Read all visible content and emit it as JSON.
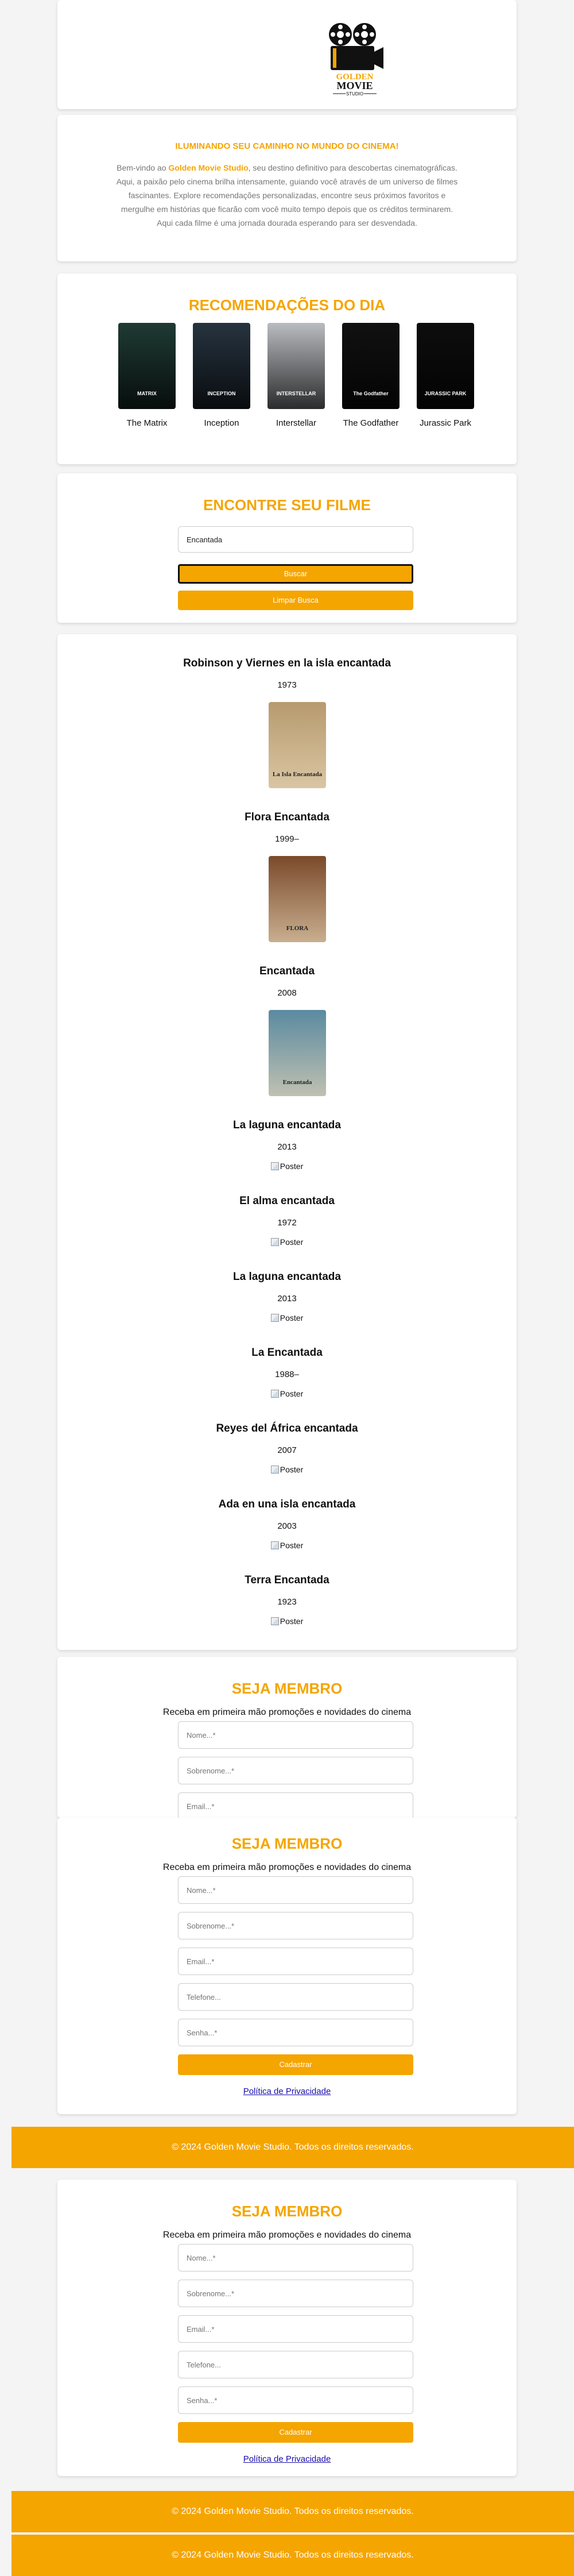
{
  "brand": {
    "logo_line1": "GOLDEN",
    "logo_line2": "MOVIE",
    "logo_line3": "STUDIO"
  },
  "intro": {
    "title": "ILUMINANDO SEU CAMINHO NO MUNDO DO CINEMA!",
    "text_before": "Bem-vindo ao ",
    "brand_name": "Golden Movie Studio",
    "text_after": ", seu destino definitivo para descobertas cinematográficas. Aqui, a paixão pelo cinema brilha intensamente, guiando você através de um universo de filmes fascinantes. Explore recomendações personalizadas, encontre seus próximos favoritos e mergulhe em histórias que ficarão com você muito tempo depois que os créditos terminarem. Aqui cada filme é uma jornada dourada esperando para ser desvendada."
  },
  "recommendations": {
    "title": "RECOMENDAÇÕES DO DIA",
    "items": [
      {
        "label": "The Matrix",
        "poster_color": "#1f3a34",
        "poster_text": "MATRIX"
      },
      {
        "label": "Inception",
        "poster_color": "#26333f",
        "poster_text": "INCEPTION"
      },
      {
        "label": "Interstellar",
        "poster_color": "#b9bcc0",
        "poster_text": "INTERSTELLAR"
      },
      {
        "label": "The Godfather",
        "poster_color": "#111111",
        "poster_text": "The Godfather"
      },
      {
        "label": "Jurassic Park",
        "poster_color": "#0d0d0d",
        "poster_text": "JURASSIC PARK"
      }
    ]
  },
  "search": {
    "title": "ENCONTRE SEU FILME",
    "input_value": "Encantada",
    "search_button": "Buscar",
    "clear_button": "Limpar Busca"
  },
  "results": {
    "broken_alt": "Poster",
    "items": [
      {
        "title": "Robinson y Viernes en la isla encantada",
        "year": "1973",
        "poster_color": "#b79a6e",
        "poster_text": "La Isla Encantada",
        "has_poster": true
      },
      {
        "title": "Flora Encantada",
        "year": "1999–",
        "poster_color": "#7a4a2a",
        "poster_text": "FLORA",
        "has_poster": true
      },
      {
        "title": "Encantada",
        "year": "2008",
        "poster_color": "#5a8aa0",
        "poster_text": "Encantada",
        "has_poster": true
      },
      {
        "title": "La laguna encantada",
        "year": "2013",
        "has_poster": false
      },
      {
        "title": "El alma encantada",
        "year": "1972",
        "has_poster": false
      },
      {
        "title": "La laguna encantada",
        "year": "2013",
        "has_poster": false
      },
      {
        "title": "La Encantada",
        "year": "1988–",
        "has_poster": false
      },
      {
        "title": "Reyes del África encantada",
        "year": "2007",
        "has_poster": false
      },
      {
        "title": "Ada en una isla encantada",
        "year": "2003",
        "has_poster": false
      },
      {
        "title": "Terra Encantada",
        "year": "1923",
        "has_poster": false
      }
    ]
  },
  "member": {
    "title": "SEJA MEMBRO",
    "subtitle": "Receba em primeira mão promoções e novidades do cinema",
    "fields": {
      "nome": "Nome...*",
      "sobrenome": "Sobrenome...*",
      "email": "Email...*",
      "telefone": "Telefone...",
      "senha": "Senha...*"
    },
    "submit": "Cadastrar",
    "privacy": "Política de Privacidade"
  },
  "footer": {
    "text": "© 2024 Golden Movie Studio. Todos os direitos reservados."
  },
  "colors": {
    "accent": "#f5a500",
    "link": "#1a0dab"
  }
}
